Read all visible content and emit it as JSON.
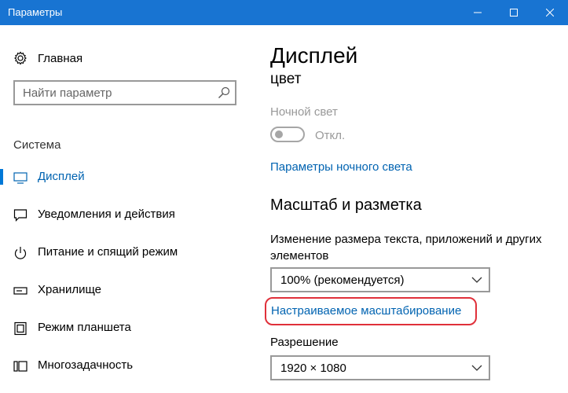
{
  "window": {
    "title": "Параметры"
  },
  "sidebar": {
    "home_label": "Главная",
    "search_placeholder": "Найти параметр",
    "section_title": "Система",
    "items": [
      {
        "label": "Дисплей",
        "icon": "monitor-icon",
        "active": true
      },
      {
        "label": "Уведомления и действия",
        "icon": "notification-icon",
        "active": false
      },
      {
        "label": "Питание и спящий режим",
        "icon": "power-icon",
        "active": false
      },
      {
        "label": "Хранилище",
        "icon": "storage-icon",
        "active": false
      },
      {
        "label": "Режим планшета",
        "icon": "tablet-icon",
        "active": false
      },
      {
        "label": "Многозадачность",
        "icon": "multitask-icon",
        "active": false
      }
    ]
  },
  "main": {
    "page_title": "Дисплей",
    "color_heading": "цвет",
    "night_light_label": "Ночной свет",
    "night_light_state": "Откл.",
    "night_light_settings_link": "Параметры ночного света",
    "scale_heading": "Масштаб и разметка",
    "scale_description": "Изменение размера текста, приложений и других элементов",
    "scale_value": "100% (рекомендуется)",
    "custom_scaling_link": "Настраиваемое масштабирование",
    "resolution_label": "Разрешение",
    "resolution_value": "1920 × 1080"
  },
  "colors": {
    "titlebar": "#1874d2",
    "accent": "#0078d7",
    "link": "#0063b1",
    "highlight": "#e0303a"
  }
}
